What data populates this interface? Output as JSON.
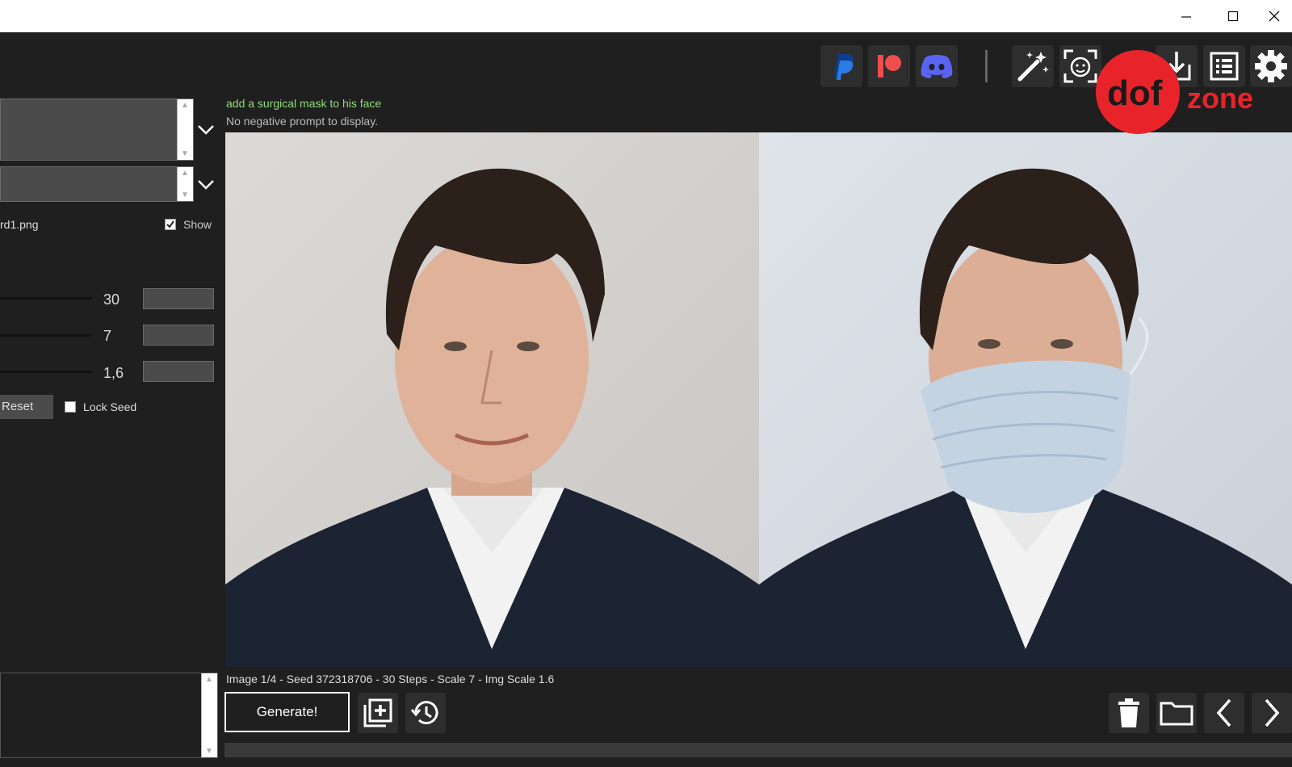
{
  "window": {
    "minimize_icon": "minimize-icon",
    "maximize_icon": "maximize-icon",
    "close_icon": "close-icon"
  },
  "toolbar": {
    "icons": [
      "paypal-icon",
      "patreon-icon",
      "discord-icon",
      "magic-wand-icon",
      "face-scan-icon",
      "install-icon",
      "list-icon",
      "gear-icon"
    ],
    "colors": {
      "paypal": "#1f5fcf",
      "patreon": "#f04e4e",
      "discord": "#5865f2"
    }
  },
  "watermark": {
    "logo_text": "dof",
    "zone_text": "zone",
    "color": "#e8242a"
  },
  "left_panel": {
    "init_image_name": "rd1.png",
    "show_label": "Show",
    "show_checked": true,
    "steps_value": "30",
    "scale_value": "7",
    "img_scale_value": "1,6",
    "reset_label": "Reset",
    "lock_seed_label": "Lock Seed",
    "lock_seed_checked": false
  },
  "prompt": {
    "text": "add a surgical mask to his face",
    "negative": "No negative prompt to display."
  },
  "status": {
    "text": "Image 1/4  - Seed 372318706 - 30 Steps - Scale 7 - Img Scale 1.6"
  },
  "bottom": {
    "generate_label": "Generate!",
    "icons": [
      "add-queue-icon",
      "history-icon",
      "trash-icon",
      "folder-icon",
      "previous-icon",
      "next-icon"
    ]
  }
}
